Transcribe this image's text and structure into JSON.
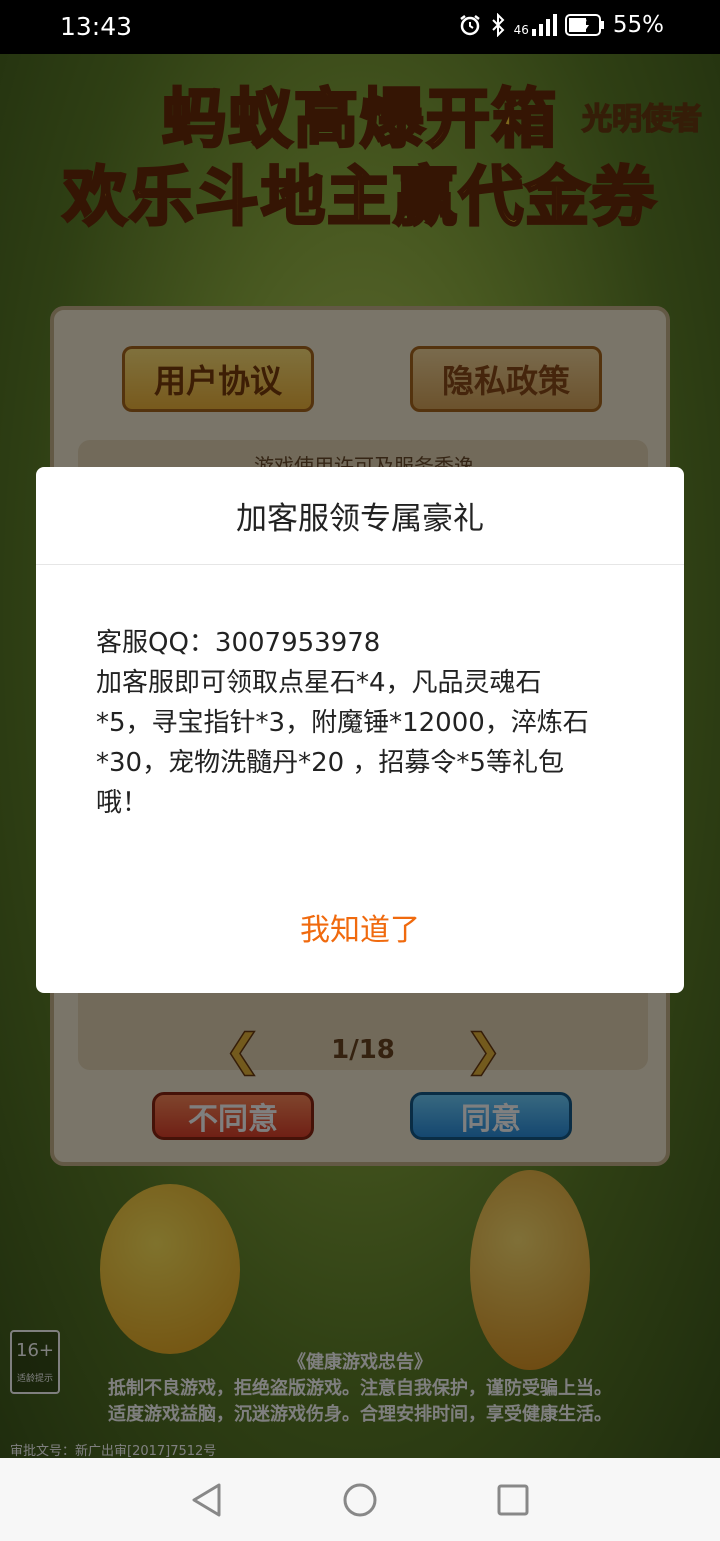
{
  "status_bar": {
    "time": "13:43",
    "network": "46",
    "battery_percent": "55%",
    "icons": [
      "alarm-icon",
      "bluetooth-icon",
      "signal-icon",
      "battery-icon"
    ]
  },
  "game": {
    "title_line1": "蚂蚁高爆开箱",
    "title_line2": "欢乐斗地主赢代金券",
    "badge": "光明使者",
    "tabs": [
      "用户协议",
      "隐私政策"
    ],
    "license_heading": "游戏使用许可及服务秀逸",
    "page_indicator": "1/18",
    "disagree_label": "不同意",
    "agree_label": "同意",
    "age_rating": "16+",
    "age_rating_note": "适龄提示",
    "health_notice_title": "《健康游戏忠告》",
    "health_notice_line1": "抵制不良游戏，拒绝盗版游戏。注意自我保护，谨防受骗上当。",
    "health_notice_line2": "适度游戏益脑，沉迷游戏伤身。合理安排时间，享受健康生活。",
    "approval_number": "审批文号：新广出审[2017]7512号"
  },
  "dialog": {
    "title": "加客服领专属豪礼",
    "body_lines": [
      "客服QQ：3007953978",
      "加客服即可领取点星石*4，凡品灵魂石",
      "*5，寻宝指针*3，附魔锤*12000，淬炼石",
      "*30，宠物洗髓丹*20 ，招募令*5等礼包",
      "哦！"
    ],
    "confirm_label": "我知道了",
    "accent_color": "#f06a0e"
  },
  "nav_bar": {
    "buttons": [
      "back-icon",
      "home-icon",
      "recents-icon"
    ]
  }
}
